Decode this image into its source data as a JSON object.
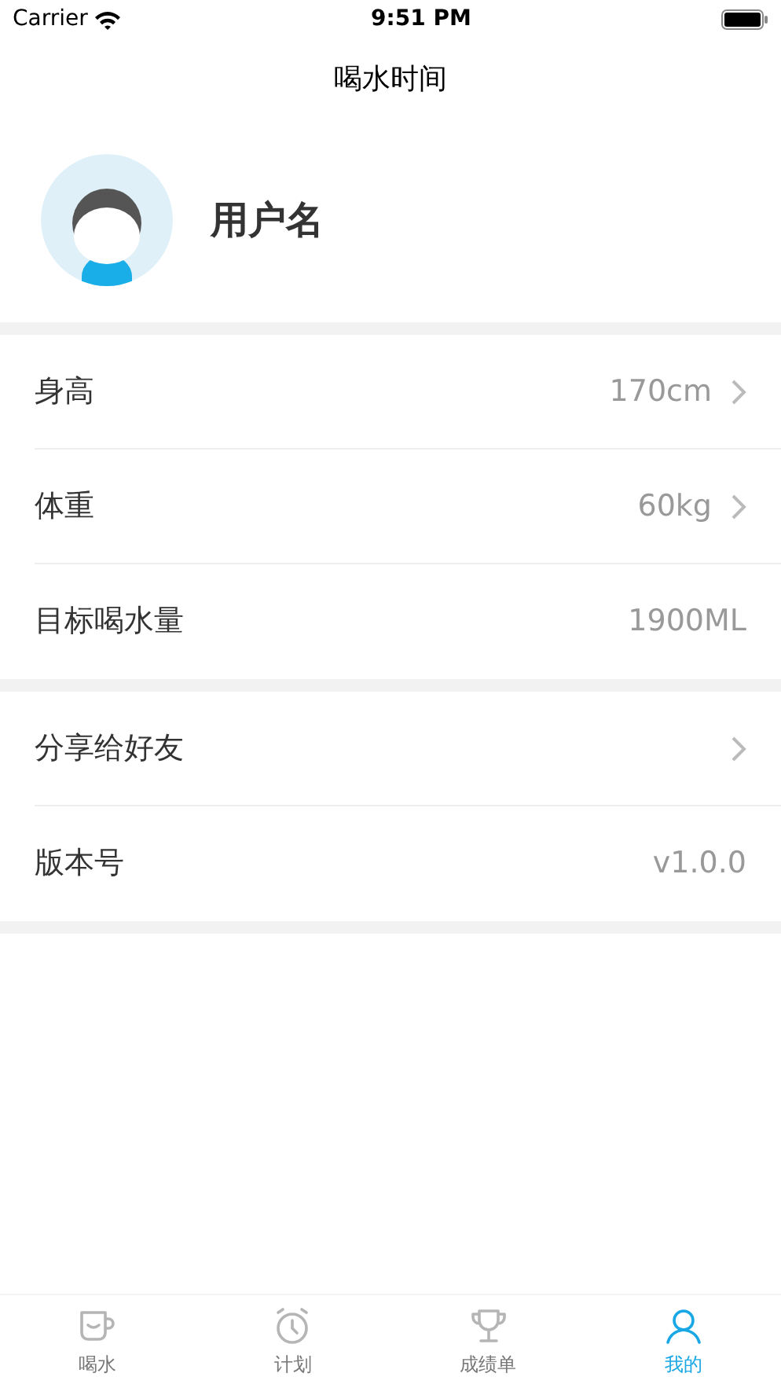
{
  "status_bar": {
    "carrier": "Carrier",
    "time": "9:51 PM"
  },
  "nav": {
    "title": "喝水时间"
  },
  "profile": {
    "name": "用户名"
  },
  "sections": [
    {
      "rows": [
        {
          "label": "身高",
          "value": "170cm",
          "chevron": true
        },
        {
          "label": "体重",
          "value": "60kg",
          "chevron": true
        },
        {
          "label": "目标喝水量",
          "value": "1900ML",
          "chevron": false
        }
      ]
    },
    {
      "rows": [
        {
          "label": "分享给好友",
          "chevron": true
        },
        {
          "label": "版本号",
          "value": "v1.0.0",
          "chevron": false
        }
      ]
    }
  ],
  "tabs": [
    {
      "label": "喝水",
      "kind": "cup",
      "selected": false
    },
    {
      "label": "计划",
      "kind": "clock",
      "selected": false
    },
    {
      "label": "成绩单",
      "kind": "trophy",
      "selected": false
    },
    {
      "label": "我的",
      "kind": "person",
      "selected": true
    }
  ]
}
